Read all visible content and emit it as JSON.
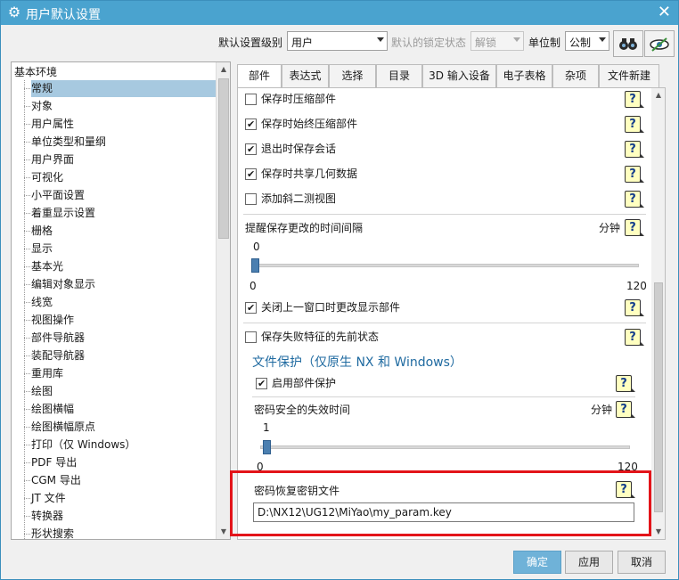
{
  "window": {
    "title": "用户默认设置",
    "icon": "gear-icon",
    "close_icon": "close-icon"
  },
  "toolbar": {
    "level_label": "默认设置级别",
    "level_value": "用户",
    "lock_label": "默认的锁定状态",
    "lock_value": "解锁",
    "unit_label": "单位制",
    "unit_value": "公制",
    "find_icon": "binoculars-icon",
    "view_icon": "eye-icon"
  },
  "tree": {
    "root": "基本环境",
    "items": [
      "常规",
      "对象",
      "用户属性",
      "单位类型和量纲",
      "用户界面",
      "可视化",
      "小平面设置",
      "着重显示设置",
      "栅格",
      "显示",
      "基本光",
      "编辑对象显示",
      "线宽",
      "视图操作",
      "部件导航器",
      "装配导航器",
      "重用库",
      "绘图",
      "绘图横幅",
      "绘图横幅原点",
      "打印（仅 Windows）",
      "PDF 导出",
      "CGM 导出",
      "JT 文件",
      "转换器",
      "形状搜索"
    ],
    "selected_index": 0
  },
  "tabs": [
    {
      "label": "部件",
      "active": true
    },
    {
      "label": "表达式"
    },
    {
      "label": "选择"
    },
    {
      "label": "目录"
    },
    {
      "label": "3D 输入设备"
    },
    {
      "label": "电子表格"
    },
    {
      "label": "杂项"
    },
    {
      "label": "文件新建"
    }
  ],
  "panel": {
    "options": [
      {
        "label": "保存时压缩部件",
        "checked": false
      },
      {
        "label": "保存时始终压缩部件",
        "checked": true
      },
      {
        "label": "退出时保存会话",
        "checked": true
      },
      {
        "label": "保存时共享几何数据",
        "checked": true
      },
      {
        "label": "添加斜二测视图",
        "checked": false
      }
    ],
    "remind_label": "提醒保存更改的时间间隔",
    "remind_unit": "分钟",
    "remind_value": "0",
    "remind_min": "0",
    "remind_max": "120",
    "remind_fraction": 0.0,
    "close_window_label": "关闭上一窗口时更改显示部件",
    "close_window_checked": true,
    "save_failed_label": "保存失败特征的先前状态",
    "save_failed_checked": false,
    "protect_title": "文件保护（仅原生 NX 和 Windows）",
    "enable_protect_label": "启用部件保护",
    "enable_protect_checked": true,
    "pwd_expire_label": "密码安全的失效时间",
    "pwd_expire_unit": "分钟",
    "pwd_expire_value": "1",
    "pwd_expire_min": "0",
    "pwd_expire_max": "120",
    "pwd_expire_fraction": 0.008,
    "recovery_label": "密码恢复密钥文件",
    "recovery_value": "D:\\NX12\\UG12\\MiYao\\my_param.key",
    "help_glyph": "?"
  },
  "buttons": {
    "ok": "确定",
    "apply": "应用",
    "cancel": "取消"
  },
  "colors": {
    "titlebar": "#4aa3cf",
    "highlight_box": "#e3141a",
    "selected_tree": "#a7c9e0",
    "primary_button": "#6fb2d8"
  }
}
